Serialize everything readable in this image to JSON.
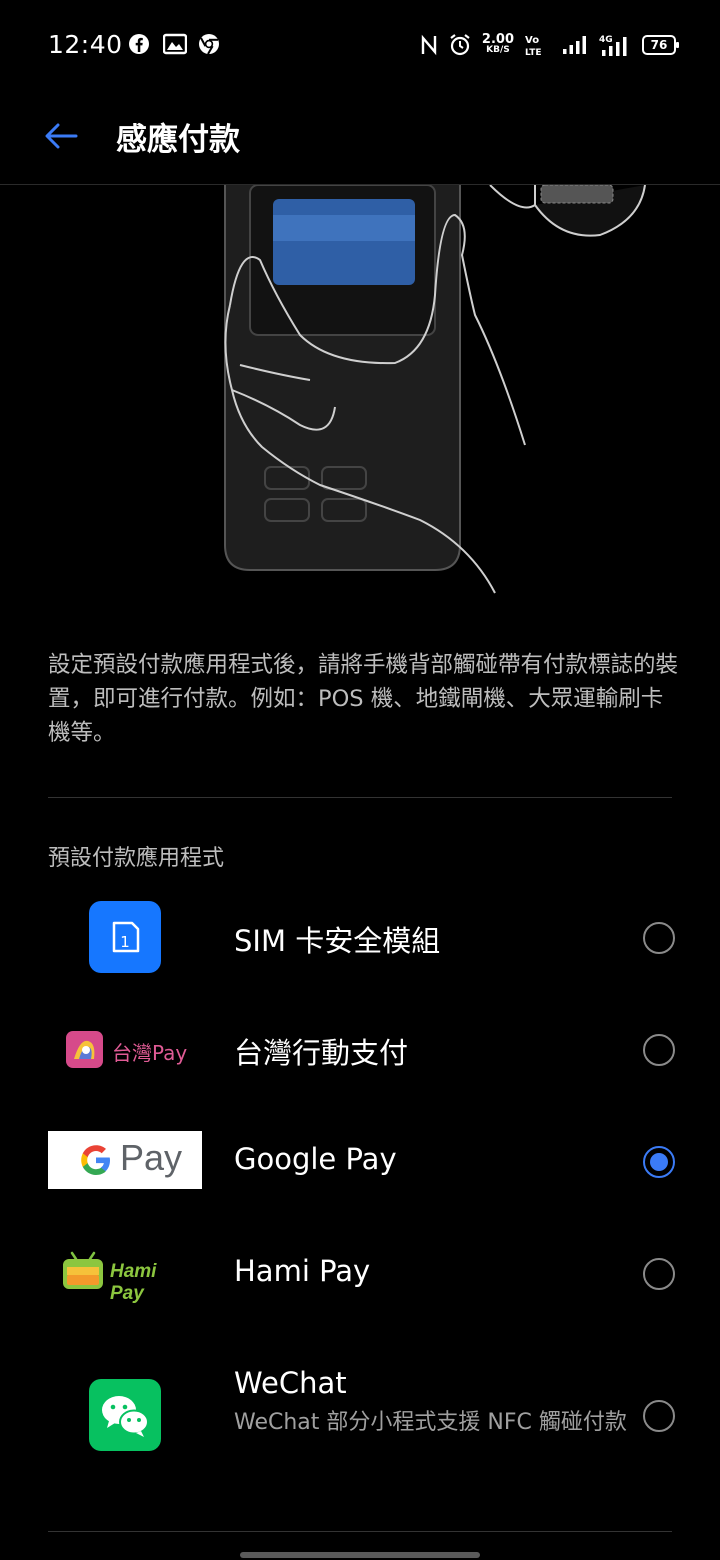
{
  "status": {
    "time": "12:40",
    "speed_value": "2.00",
    "speed_unit": "KB/S",
    "battery": "76"
  },
  "header": {
    "title": "感應付款"
  },
  "description": "設定預設付款應用程式後，請將手機背部觸碰帶有付款標誌的裝置，即可進行付款。例如：POS 機、地鐵閘機、大眾運輸刷卡機等。",
  "section_title": "預設付款應用程式",
  "payment_apps": [
    {
      "label": "SIM 卡安全模組",
      "logo_text": "1",
      "selected": false
    },
    {
      "label": "台灣行動支付",
      "logo_text": "台灣Pay",
      "selected": false
    },
    {
      "label": "Google Pay",
      "logo_text": "Pay",
      "selected": true
    },
    {
      "label": "Hami Pay",
      "logo_text": "Hami Pay",
      "selected": false
    },
    {
      "label": "WeChat",
      "sublabel": "WeChat 部分小程式支援 NFC 觸碰付款",
      "selected": false
    }
  ],
  "colors": {
    "accent": "#3b7bf6",
    "background": "#000000",
    "sim_blue": "#1677ff",
    "wechat_green": "#07c160"
  }
}
